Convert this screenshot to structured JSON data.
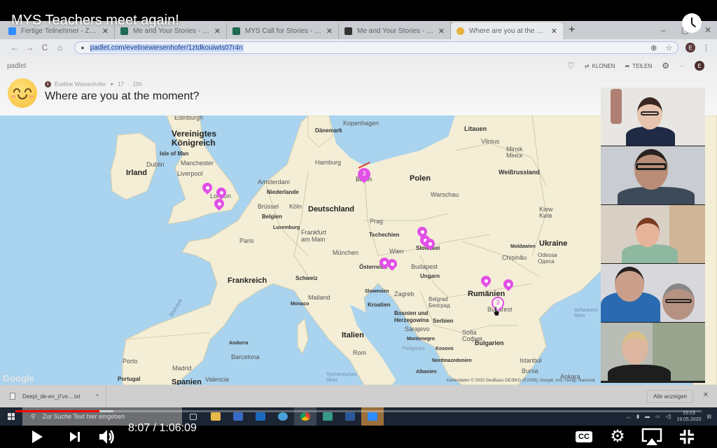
{
  "video": {
    "title": "MYS Teachers meet again!",
    "current_time": "8:07",
    "duration": "1:06:09",
    "time_separator": "/",
    "progress_fraction": 0.122,
    "buffered_fraction": 0.143,
    "controls": {
      "play": "play-icon",
      "next": "next-icon",
      "volume": "volume-icon",
      "captions": "CC",
      "settings": "gear-icon",
      "airplay": "airplay-icon",
      "exit_fullscreen": "exit-fullscreen-icon",
      "watch_later": "clock-icon"
    },
    "progress_color": "#ff0000"
  },
  "browser": {
    "tabs": [
      {
        "title": "Fertige Teilnehmer - Zoom",
        "favicon_color": "#2d8cff",
        "active": false
      },
      {
        "title": "Me and Your Stories - atempo",
        "favicon_color": "#1f6b52",
        "active": false
      },
      {
        "title": "MYS Call for Stories - atempo",
        "favicon_color": "#1f6b52",
        "active": false
      },
      {
        "title": "Me and Your Stories - MYS - Wiki",
        "favicon_color": "#333333",
        "active": false
      },
      {
        "title": "Where are you at the moment?",
        "favicon_color": "#e6b23a",
        "active": true
      }
    ],
    "new_tab": "+",
    "tab_close": "✕",
    "window_controls": {
      "minimize": "–",
      "maximize": "▢",
      "close": "✕"
    },
    "nav": {
      "back": "←",
      "forward": "→",
      "reload": "C",
      "home": "⌂"
    },
    "url": "padlet.com/evelinewiesenhofer/1ztdkouiwts07r4n",
    "lock": "🔒",
    "profile_initial": "E"
  },
  "padlet": {
    "logo": "padlet",
    "actions": {
      "like": "♡",
      "clone": "KLONEN",
      "share": "TEILEN",
      "settings": "gear-icon",
      "more": "···",
      "avatar_initial": "E"
    },
    "author": "Eveline Wiesenhofer",
    "author_initial": "E",
    "post_count": "17",
    "post_count_prefix": "✦",
    "age": "15h",
    "separator": "·",
    "title": "Where are you at the moment?",
    "pin_color": "#e24fe6"
  },
  "map": {
    "labels": {
      "edinburgh": "Edinburgh",
      "uk": "Vereinigtes\nKönigreich",
      "isle_of_man": "Isle of Man",
      "irland": "Irland",
      "dublin": "Dublin",
      "manchester": "Manchester",
      "liverpool": "Liverpool",
      "london": "London",
      "amsterdam": "Amsterdam",
      "niederlande": "Niederlande",
      "bruessel": "Brüssel",
      "belgien": "Belgien",
      "koeln": "Köln",
      "luxemburg": "Luxemburg",
      "paris": "Paris",
      "frankfurt": "Frankfurt\nam Main",
      "deutschland": "Deutschland",
      "frankreich": "Frankreich",
      "schweiz": "Schweiz",
      "muenchen": "München",
      "kopenhagen": "Kopenhagen",
      "daenemark": "Dänemark",
      "hamburg": "Hamburg",
      "berlin": "Berlin",
      "polen": "Polen",
      "warschau": "Warschau",
      "litauen": "Litauen",
      "vilnius": "Vilnius",
      "minsk": "Minsk\nМінск",
      "weissrussland": "Weißrussland",
      "kiew": "Kiew\nKиїв",
      "ukraine": "Ukraine",
      "prag": "Prag",
      "tschechien": "Tschechien",
      "wien": "Wien",
      "slowakei": "Slowakei",
      "oesterreich": "Österreich",
      "budapest": "Budapest",
      "ungarn": "Ungarn",
      "slowenien": "Slowenien",
      "zagreb": "Zagreb",
      "kroatien": "Kroatien",
      "mailand": "Mailand",
      "bosnien": "Bosnien und\nHerzegowina",
      "sarajevo": "Sarajevo",
      "serbien": "Serbien",
      "belgrad": "Belgrad\nБеоград",
      "montenegro": "Montenegro",
      "podgorica": "Podgorica",
      "kosovo": "Kosovo",
      "nordmazedonien": "Nordmazedonien",
      "albanien": "Albanien",
      "italien": "Italien",
      "rom": "Rom",
      "tyrrhenisches": "Tyrrhenisches\nMeer",
      "rumaenien": "Rumänien",
      "bukarest": "Bukarest",
      "moldawien": "Moldawien",
      "chisinau": "Chișinău",
      "odessa": "Odessa\nОдеса",
      "sofia": "Sofia\nСофия",
      "bulgarien": "Bulgarien",
      "schwarzes_meer": "Schwarzes\nMeer",
      "istanbul": "Istanbul",
      "bursa": "Bursa",
      "ankara": "Ankara",
      "monaco": "Monaco",
      "andorra": "Andorra",
      "barcelona": "Barcelona",
      "porto": "Porto",
      "madrid": "Madrid",
      "portugal": "Portugal",
      "spanien": "Spanien",
      "valencia": "Valencia",
      "biskaya": "Biskaya"
    },
    "google_logo": "Google",
    "attribution": "Kartendaten © 2020 GeoBasis-DE/BKG (©2009), Google, Inst. Geogr. Nacional"
  },
  "pins": [
    {
      "location": "England (Oxford)",
      "count": 1
    },
    {
      "location": "London",
      "count": 1
    },
    {
      "location": "South England",
      "count": 1
    },
    {
      "location": "Berlin",
      "count": 3
    },
    {
      "location": "Slowakei",
      "count": 1
    },
    {
      "location": "Slowakei",
      "count": 1
    },
    {
      "location": "Slowakei",
      "count": 1
    },
    {
      "location": "Österreich",
      "count": 1
    },
    {
      "location": "Österreich",
      "count": 1
    },
    {
      "location": "Rumänien",
      "count": 1
    },
    {
      "location": "Rumänien (Ost)",
      "count": 1
    },
    {
      "location": "Bukarest",
      "count": 3
    }
  ],
  "zoom_gallery": {
    "participants": [
      {
        "label": "participant-1"
      },
      {
        "label": "participant-2"
      },
      {
        "label": "participant-3"
      },
      {
        "label": "participant-4"
      },
      {
        "label": "participant-5"
      }
    ]
  },
  "downloads": {
    "file": "Deepl_de-en_(I've....txt",
    "chevron": "^",
    "show_all": "Alle anzeigen",
    "close": "✕"
  },
  "taskbar": {
    "search_placeholder": "Zur Suche Text hier eingeben",
    "apps": [
      "task-view",
      "file-explorer",
      "network",
      "outlook",
      "app-globe",
      "chrome",
      "app-green",
      "word",
      "zoom"
    ],
    "time": "15:13",
    "date": "19.05.2020"
  }
}
